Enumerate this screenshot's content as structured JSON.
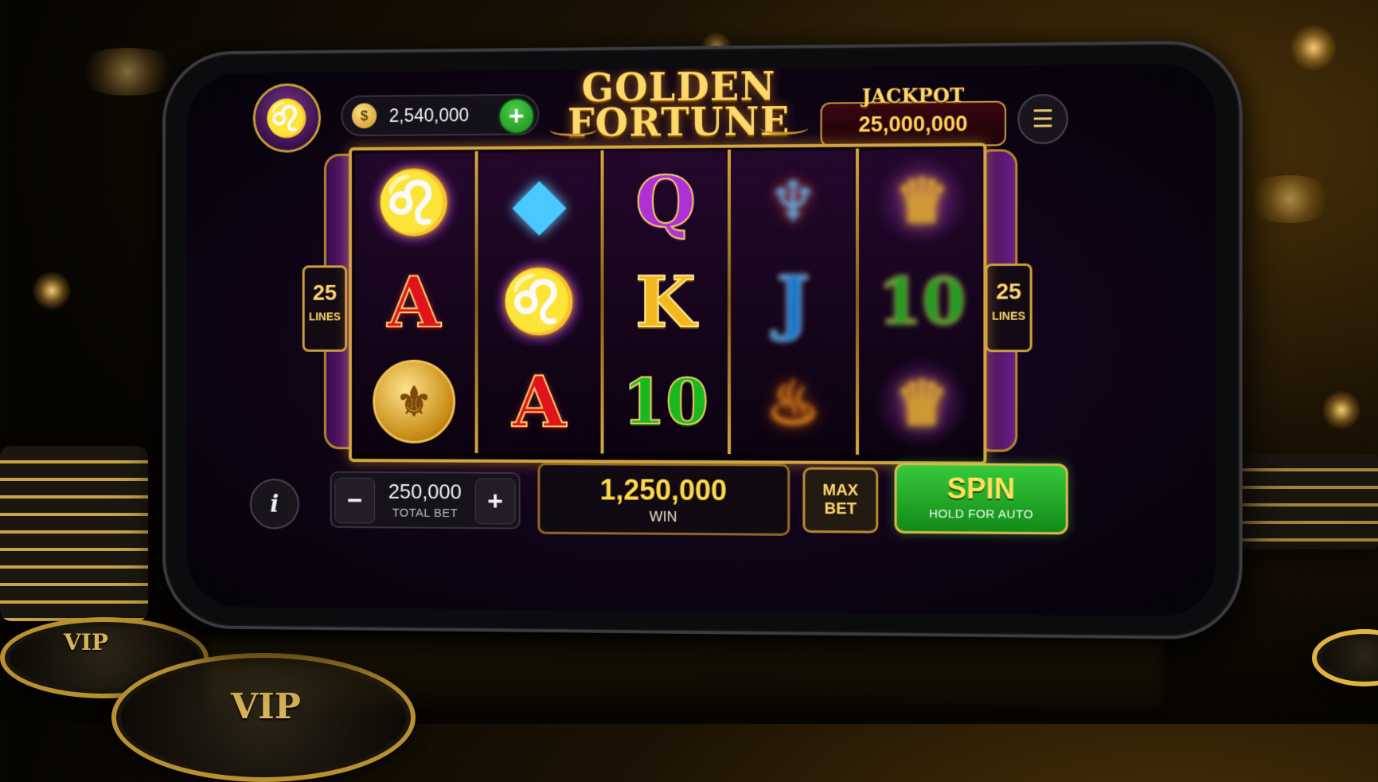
{
  "game": {
    "title_line1": "GOLDEN",
    "title_line2": "FORTUNE"
  },
  "topbar": {
    "balance": "2,540,000",
    "add_label": "+",
    "jackpot_label": "JACKPOT",
    "jackpot_value": "25,000,000",
    "menu_icon": "hamburger-menu-icon"
  },
  "side": {
    "left_lines_num": "25",
    "left_lines_label": "LINES",
    "right_lines_num": "25",
    "right_lines_label": "LINES"
  },
  "reels": [
    [
      "lion",
      "A",
      "coin"
    ],
    [
      "diamond",
      "lion",
      "A"
    ],
    [
      "Q",
      "K",
      "10"
    ],
    [
      "bird",
      "J",
      "flame"
    ],
    [
      "crown",
      "10",
      "crown"
    ]
  ],
  "bottombar": {
    "info_label": "i",
    "minus_label": "−",
    "plus_label": "+",
    "bet_value": "250,000",
    "bet_label": "TOTAL BET",
    "win_value": "1,250,000",
    "win_label": "WIN",
    "max_bet_line1": "MAX",
    "max_bet_line2": "BET",
    "spin_label": "SPIN",
    "spin_sub": "HOLD FOR AUTO"
  },
  "decor": {
    "chip_text": "VIP"
  },
  "colors": {
    "gold": "#ffd86a",
    "spin_green": "#1a8a1d",
    "jackpot_red": "#3a0610",
    "reel_purple": "#3a1050"
  }
}
